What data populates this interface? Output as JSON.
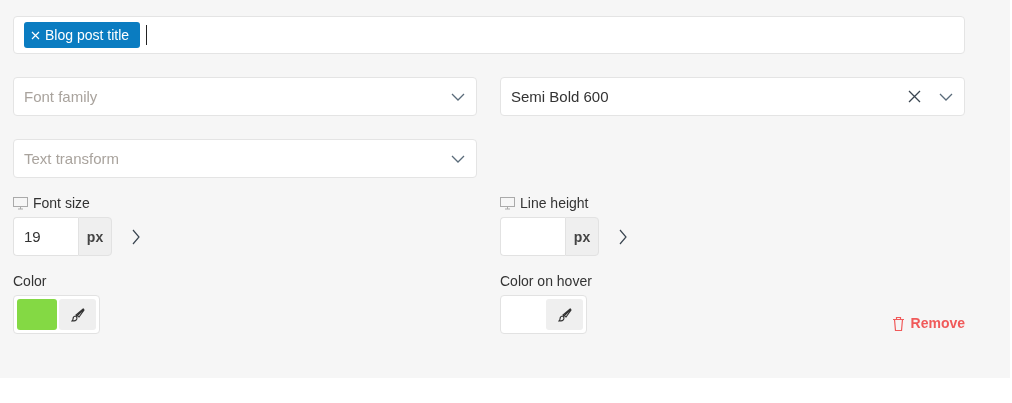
{
  "tag_field": {
    "tags": [
      {
        "label": "Blog post title"
      }
    ]
  },
  "selects": [
    {
      "placeholder": "Font family"
    },
    {
      "value": "Semi Bold 600",
      "clearable": true
    },
    {
      "placeholder": "Text transform"
    }
  ],
  "size_fields": [
    {
      "label": "Font size",
      "value": "19",
      "unit": "px"
    },
    {
      "label": "Line height",
      "unit": "px"
    }
  ],
  "color_fields": [
    {
      "label": "Color",
      "color": "#84d944"
    },
    {
      "label": "Color on hover"
    }
  ],
  "remove_button": {
    "label": "Remove"
  }
}
